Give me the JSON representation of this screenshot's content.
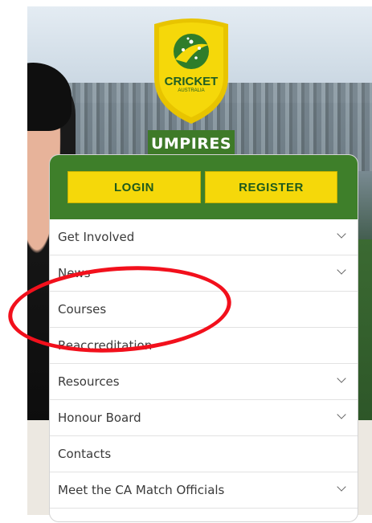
{
  "brand": {
    "logo_line1": "CRICKET",
    "logo_line2": "AUSTRALIA",
    "section": "UMPIRES",
    "colors": {
      "green": "#3e7f2a",
      "yellow": "#f5d80a",
      "gold": "#e8c400"
    }
  },
  "auth": {
    "login_label": "LOGIN",
    "register_label": "REGISTER"
  },
  "menu": {
    "items": [
      {
        "label": "Get Involved",
        "has_submenu": true
      },
      {
        "label": "News",
        "has_submenu": true
      },
      {
        "label": "Courses",
        "has_submenu": false
      },
      {
        "label": "Reaccreditation",
        "has_submenu": false
      },
      {
        "label": "Resources",
        "has_submenu": true
      },
      {
        "label": "Honour Board",
        "has_submenu": true
      },
      {
        "label": "Contacts",
        "has_submenu": false
      },
      {
        "label": "Meet the CA Match Officials",
        "has_submenu": true
      }
    ],
    "chevron_icon": "chevron-down-icon"
  },
  "annotation": {
    "color": "#f2101c",
    "shape": "ellipse",
    "target": "Courses"
  }
}
